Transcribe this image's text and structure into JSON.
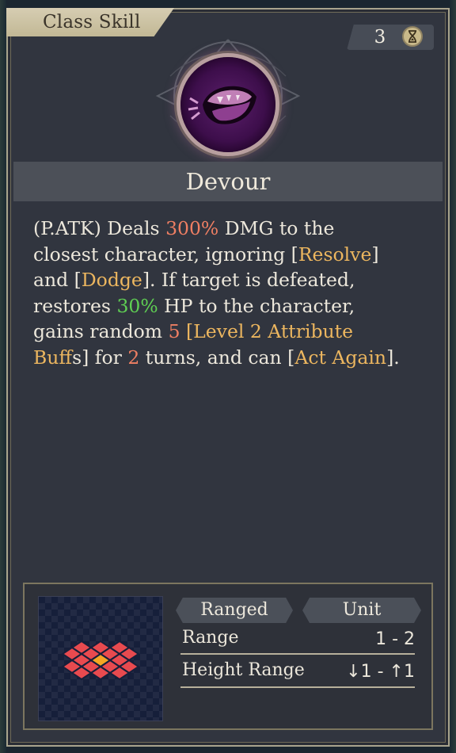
{
  "header": {
    "class_tab": "Class Skill",
    "turns": "3",
    "hourglass_icon": "hourglass-icon"
  },
  "skill": {
    "icon": "devour-mouth-icon",
    "name": "Devour",
    "description": {
      "l1a": "(P.ATK) Deals ",
      "l1b": "300%",
      "l1c": " DMG to the",
      "l2a": "closest character, ignoring ",
      "l2b": "[",
      "l2c": "Resolve",
      "l2d": "]",
      "l3a": "and ",
      "l3b": "[",
      "l3c": "Dodge",
      "l3d": "]. If target is defeated,",
      "l4a": "restores ",
      "l4b": "30%",
      "l4c": " HP to the character,",
      "l5a": "gains random ",
      "l5b": "5",
      "l5c": " ",
      "l5d": "[Level 2 Attribute",
      "l6a": "Buff",
      "l6b": "s] for ",
      "l6c": "2",
      "l6d": " turns, and can ",
      "l6e": "[",
      "l6f": "Act Again",
      "l6g": "]."
    }
  },
  "info": {
    "tag_ranged": "Ranged",
    "tag_unit": "Unit",
    "range_label": "Range",
    "range_value": "1 - 2",
    "height_label": "Height Range",
    "height_value": "↓1 - ↑1"
  },
  "colors": {
    "damage": "#ef7f63",
    "heal": "#5fcf53",
    "keyword": "#ecb65f"
  }
}
